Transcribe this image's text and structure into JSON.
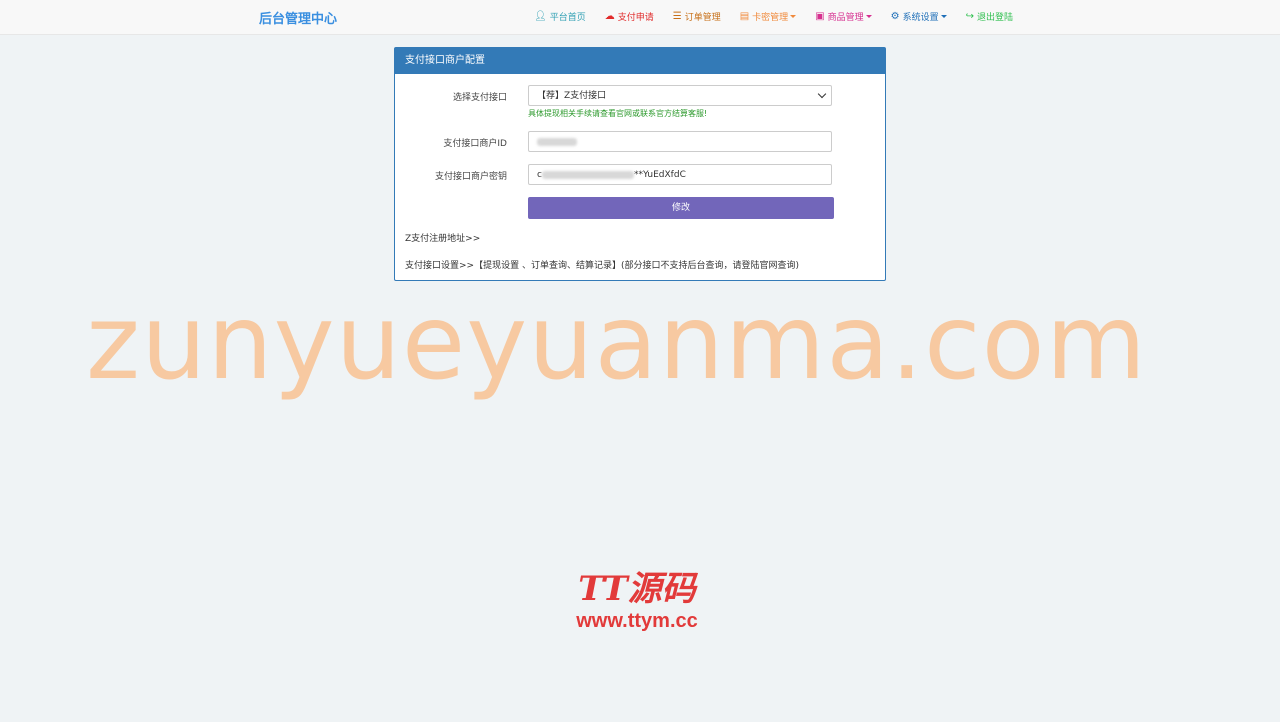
{
  "brand": "后台管理中心",
  "nav": [
    {
      "label": "平台首页",
      "icon": "user-icon",
      "color": "#2f9fb3",
      "caret": false
    },
    {
      "label": "支付申请",
      "icon": "cloud-icon",
      "color": "#e12b2b",
      "caret": false
    },
    {
      "label": "订单管理",
      "icon": "list-icon",
      "color": "#c77019",
      "caret": false
    },
    {
      "label": "卡密管理",
      "icon": "card-icon",
      "color": "#f08a3c",
      "caret": true
    },
    {
      "label": "商品管理",
      "icon": "box-icon",
      "color": "#d62f8f",
      "caret": true
    },
    {
      "label": "系统设置",
      "icon": "gear-icon",
      "color": "#1f6fb8",
      "caret": true
    },
    {
      "label": "退出登陆",
      "icon": "logout-icon",
      "color": "#2fbf4f",
      "caret": false
    }
  ],
  "panel": {
    "title": "支付接口商户配置",
    "select_label": "选择支付接口",
    "select_value": "【荐】Z支付接口",
    "help_text": "具体提现相关手续请查看官网或联系官方结算客服!",
    "merchant_id_label": "支付接口商户ID",
    "merchant_key_label": "支付接口商户密钥",
    "merchant_key_prefix": "c",
    "merchant_key_suffix": "**YuEdXfdC",
    "submit_label": "修改",
    "register_link": "Z支付注册地址>>",
    "settings_link": "支付接口设置>>【提现设置 、订单查询、结算记录】(部分接口不支持后台查询，请登陆官网查询)"
  },
  "watermark": "zunyueyuanma.com",
  "stamp": {
    "logo": "TT源码",
    "url": "www.ttym.cc"
  }
}
